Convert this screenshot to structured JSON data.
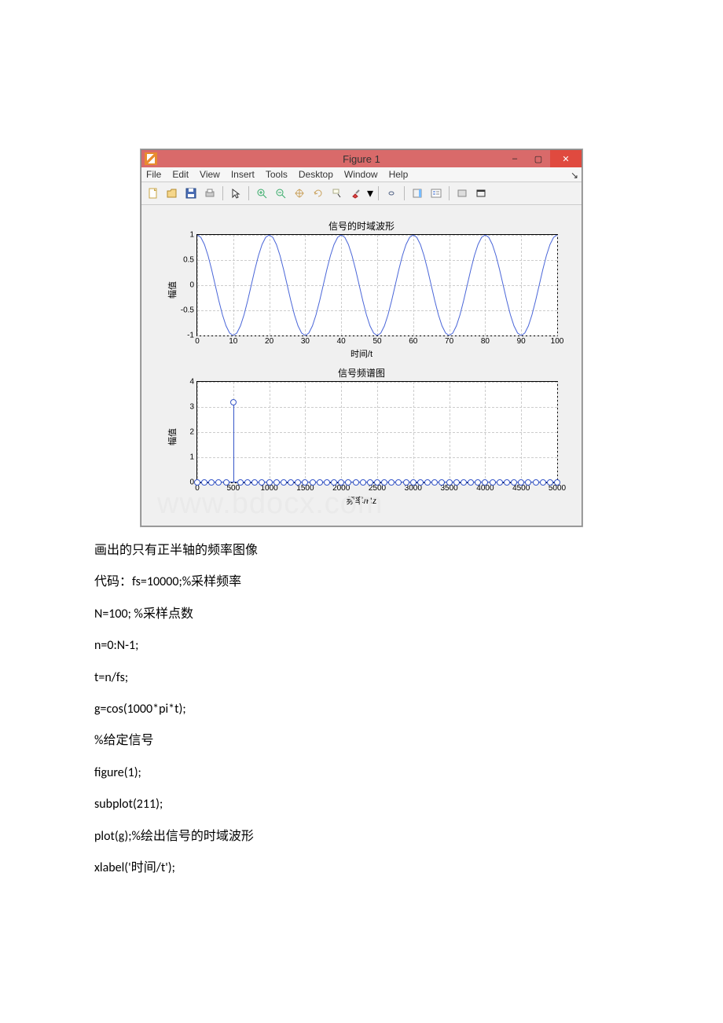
{
  "window": {
    "title": "Figure 1",
    "minimize": "–",
    "maximize": "▢",
    "close": "✕"
  },
  "menu": {
    "file": "File",
    "edit": "Edit",
    "view": "View",
    "insert": "Insert",
    "tools": "Tools",
    "desktop": "Desktop",
    "window_m": "Window",
    "help": "Help"
  },
  "chart_data": [
    {
      "type": "line",
      "title": "信号的时域波形",
      "xlabel": "时间/t",
      "ylabel": "幅值",
      "xlim": [
        0,
        100
      ],
      "ylim": [
        -1,
        1
      ],
      "xticks": [
        0,
        10,
        20,
        30,
        40,
        50,
        60,
        70,
        80,
        90,
        100
      ],
      "yticks": [
        -1,
        -0.5,
        0,
        0.5,
        1
      ],
      "series": [
        {
          "name": "g",
          "expr": "cos(1000*pi*t)",
          "fs": 10000,
          "N": 100
        }
      ]
    },
    {
      "type": "stem",
      "title": "信号频谱图",
      "xlabel": "频率/Hz",
      "ylabel": "幅值",
      "xlim": [
        0,
        5000
      ],
      "ylim": [
        0,
        4
      ],
      "xticks": [
        0,
        500,
        1000,
        1500,
        2000,
        2500,
        3000,
        3500,
        4000,
        4500,
        5000
      ],
      "yticks": [
        0,
        1,
        2,
        3,
        4
      ],
      "x": [
        0,
        100,
        200,
        300,
        400,
        500,
        600,
        700,
        800,
        900,
        1000,
        1100,
        1200,
        1300,
        1400,
        1500,
        1600,
        1700,
        1800,
        1900,
        2000,
        2100,
        2200,
        2300,
        2400,
        2500,
        2600,
        2700,
        2800,
        2900,
        3000,
        3100,
        3200,
        3300,
        3400,
        3500,
        3600,
        3700,
        3800,
        3900,
        4000,
        4100,
        4200,
        4300,
        4400,
        4500,
        4600,
        4700,
        4800,
        4900,
        5000
      ],
      "y": [
        0,
        0,
        0,
        0,
        0,
        3.2,
        0,
        0,
        0,
        0,
        0,
        0,
        0,
        0,
        0,
        0,
        0,
        0,
        0,
        0,
        0,
        0,
        0,
        0,
        0,
        0,
        0,
        0,
        0,
        0,
        0,
        0,
        0,
        0,
        0,
        0,
        0,
        0,
        0,
        0,
        0,
        0,
        0,
        0,
        0,
        0,
        0,
        0,
        0,
        0,
        0
      ]
    }
  ],
  "text": {
    "caption": "画出的只有正半轴的频率图像",
    "code1": "代码：fs=10000;%采样频率",
    "code2": "N=100;   %采样点数",
    "code3": "n=0:N-1;",
    "code4": "t=n/fs;",
    "code5": "g=cos(1000*pi*t);",
    "code6": "%给定信号",
    "code7": "figure(1);",
    "code8": "subplot(211);",
    "code9": "plot(g);%绘出信号的时域波形",
    "code10": "xlabel('时间/t');"
  },
  "watermark": "www.bdocx.com"
}
